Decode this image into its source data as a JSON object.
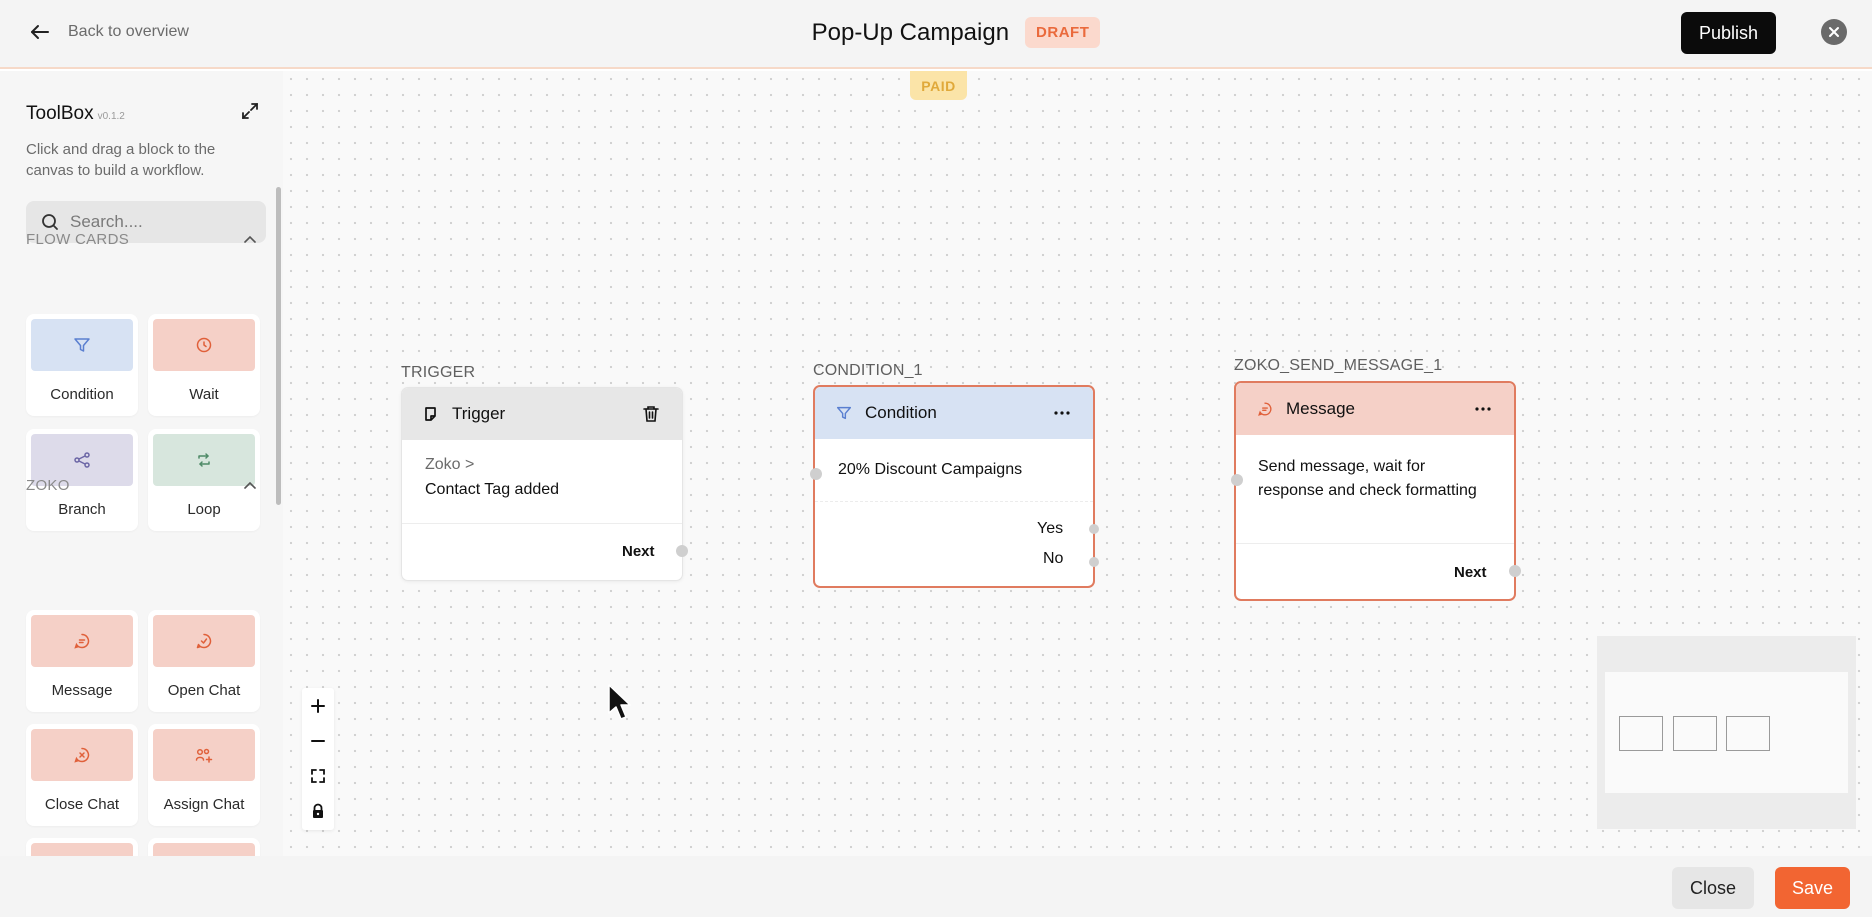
{
  "header": {
    "back_label": "Back to overview",
    "title": "Pop-Up Campaign",
    "status_badge": "DRAFT",
    "publish_label": "Publish"
  },
  "canvas": {
    "paid_badge": "PAID"
  },
  "toolbox": {
    "title": "ToolBox",
    "version": "v0.1.2",
    "description": "Click and drag a block to the canvas to build a workflow.",
    "search_placeholder": "Search....",
    "sections": [
      {
        "title": "FLOW CARDS",
        "cards": [
          {
            "label": "Condition",
            "icon": "filter-icon",
            "color": "#d7e2f3"
          },
          {
            "label": "Wait",
            "icon": "clock-icon",
            "color": "#f5d0c7"
          },
          {
            "label": "Branch",
            "icon": "branch-icon",
            "color": "#dddbea"
          },
          {
            "label": "Loop",
            "icon": "loop-icon",
            "color": "#d7e6dd"
          }
        ]
      },
      {
        "title": "ZOKO",
        "cards": [
          {
            "label": "Message",
            "icon": "message-icon",
            "color": "#f5d0c7"
          },
          {
            "label": "Open Chat",
            "icon": "open-chat-icon",
            "color": "#f5d0c7"
          },
          {
            "label": "Close Chat",
            "icon": "close-chat-icon",
            "color": "#f5d0c7"
          },
          {
            "label": "Assign Chat",
            "icon": "assign-chat-icon",
            "color": "#f5d0c7"
          }
        ]
      }
    ]
  },
  "nodes": {
    "trigger": {
      "label": "TRIGGER",
      "title": "Trigger",
      "source": "Zoko >",
      "event": "Contact Tag added",
      "next": "Next"
    },
    "condition": {
      "label": "CONDITION_1",
      "title": "Condition",
      "body": "20% Discount Campaigns",
      "yes": "Yes",
      "no": "No"
    },
    "message": {
      "label": "ZOKO_SEND_MESSAGE_1",
      "title": "Message",
      "body": "Send message, wait for response and check formatting",
      "next": "Next"
    }
  },
  "footer": {
    "close_label": "Close",
    "save_label": "Save"
  },
  "colors": {
    "accent": "#f26532",
    "draft_bg": "#fbd9cd",
    "draft_text": "#ea6a3c",
    "paid_bg": "#fbe4a8",
    "condition_header": "#d7e2f3",
    "message_header": "#f5d0c7",
    "node_border": "#e07b5f"
  }
}
